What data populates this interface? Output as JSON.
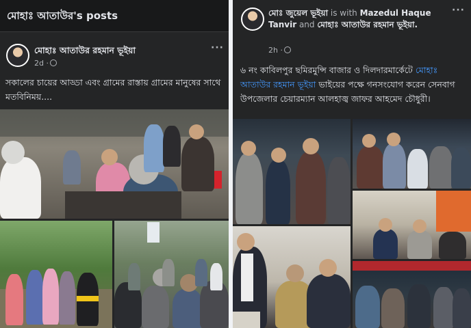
{
  "left_post": {
    "header_title": "মোহাঃ আতাউর's posts",
    "author": "মোহাঃ আতাউর রহমান ভূইয়া",
    "time": "2d ·",
    "more": "···",
    "caption": "সকালের চায়ের আড্ডা এবং গ্রামের রাস্তায় গ্রামের মানুষের সাথে মতবিনিময়....",
    "photos": [
      "tea-stall-gathering-photo",
      "village-road-photo",
      "village-people-photo"
    ]
  },
  "right_post": {
    "author": "মোঃ জুয়েল ভূইয়া",
    "with_text": " is with ",
    "tagged1": "Mazedul Haque Tanvir",
    "and_text": " and ",
    "tagged2": "মোহাঃ আতাউর রহমান ভূইয়া.",
    "time": "2h ·",
    "more": "···",
    "caption_part1": "৬ নং কাবিলপুর ছমিরমুন্সি বাজার ও দিলদারমার্কেটে ",
    "caption_link": "মোহাঃ আতাউর রহমান ভূইয়া",
    "caption_part2": " ভাইয়ের পক্ষে গনসংযোগ করেন সেনবাগ উপজেলার চেয়ারম্যান আলহাজ্ব জাফর আহমেদ চৌধুরী।",
    "photos": [
      "market-crowd-photo-1",
      "market-crowd-photo-2",
      "indoor-meeting-photo",
      "office-visit-photo",
      "night-crowd-photo"
    ]
  }
}
